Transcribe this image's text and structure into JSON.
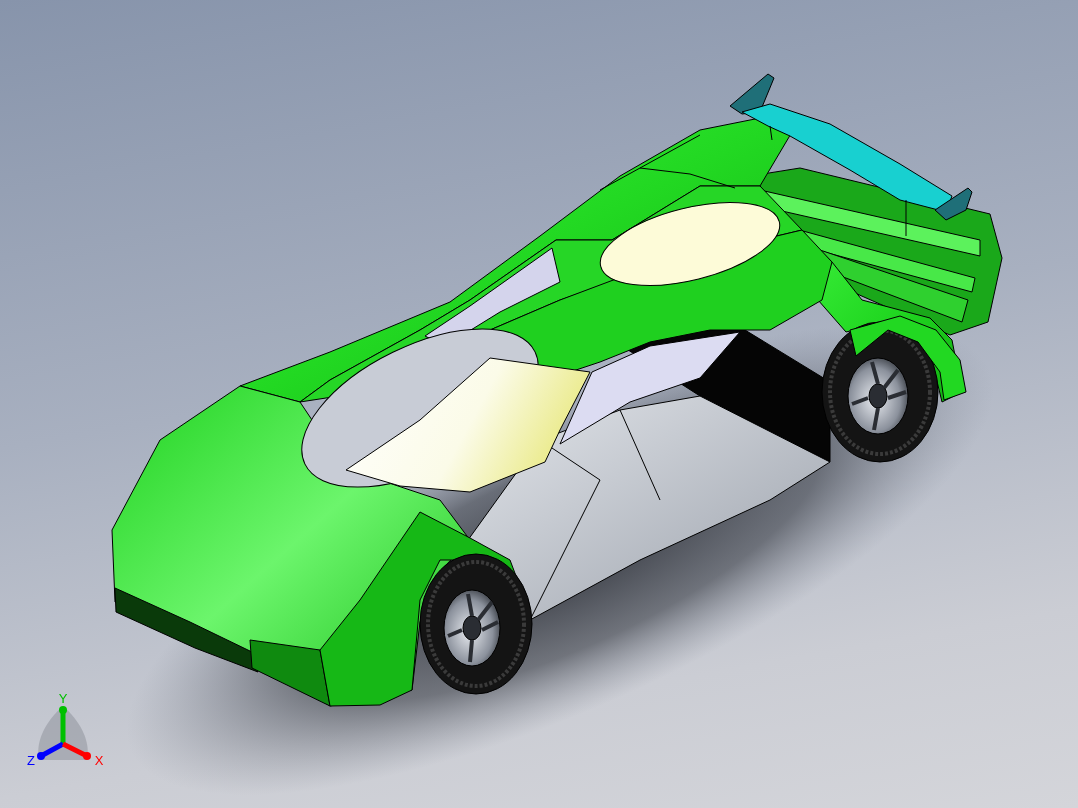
{
  "viewport": {
    "triad": {
      "axes": [
        {
          "label": "Y",
          "color": "#00c000"
        },
        {
          "label": "Z",
          "color": "#0000ff"
        },
        {
          "label": "X",
          "color": "#ff0000"
        }
      ]
    }
  }
}
